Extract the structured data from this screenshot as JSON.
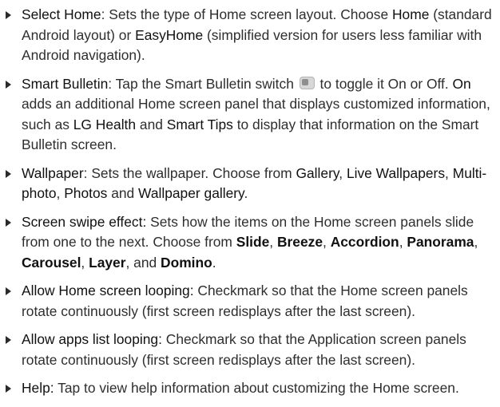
{
  "items": [
    {
      "term": "Select Home",
      "segments": [
        ": Sets the type of Home screen layout. Choose ",
        "Home",
        " (standard Android layout) or ",
        "EasyHome",
        " (simplified version for users less familiar with Android navigation)."
      ]
    },
    {
      "term": "Smart Bulletin",
      "segments": [
        ": Tap the Smart Bulletin switch ",
        " to toggle it On or Off. ",
        "On",
        " adds an additional Home screen panel that displays customized information, such as ",
        "LG Health",
        " and ",
        "Smart Tips",
        " to display that information on the Smart Bulletin screen."
      ],
      "icon": "toggle-switch-icon"
    },
    {
      "term": "Wallpaper",
      "segments": [
        ": Sets the wallpaper. Choose from ",
        "Gallery",
        ", ",
        "Live Wallpapers",
        ", ",
        "Multi-photo",
        ", ",
        "Photos",
        " and ",
        "Wallpaper gallery",
        "."
      ]
    },
    {
      "term": "Screen swipe effect:",
      "segments": [
        " Sets how the items on the Home screen panels slide from one to the next. Choose from ",
        "Slide",
        ", ",
        "Breeze",
        ", ",
        "Accordion",
        ", ",
        "Panorama",
        ", ",
        "Carousel",
        ", ",
        "Layer",
        ", and ",
        "Domino",
        "."
      ]
    },
    {
      "term": "Allow Home screen looping:",
      "segments": [
        " Checkmark so that the Home screen panels rotate continuously (first screen redisplays after the last screen)."
      ]
    },
    {
      "term": "Allow apps list looping:",
      "segments": [
        " Checkmark so that the Application screen panels rotate continuously (first screen redisplays after the last screen)."
      ]
    },
    {
      "term": "Help:",
      "segments": [
        " Tap to view help information about customizing the Home screen."
      ]
    }
  ]
}
